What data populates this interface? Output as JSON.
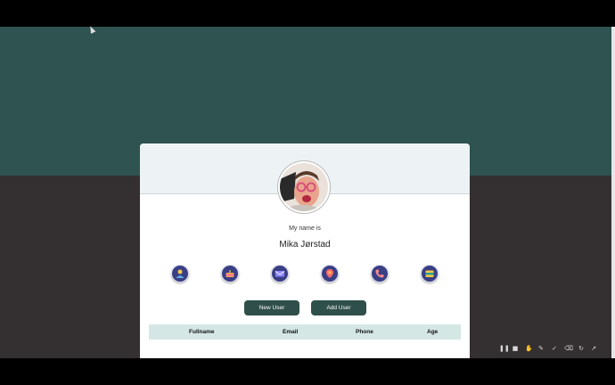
{
  "profile": {
    "intro_label": "My name is",
    "name": "Mika Jørstad"
  },
  "icons": [
    {
      "name": "user-icon",
      "color": "#f2c94c"
    },
    {
      "name": "calendar-icon",
      "color": "#f4a261"
    },
    {
      "name": "mail-icon",
      "color": "#6c63ff"
    },
    {
      "name": "map-pin-icon",
      "color": "#ff6b6b"
    },
    {
      "name": "phone-icon",
      "color": "#ff8a8a"
    },
    {
      "name": "lock-icon",
      "color": "#f2c94c"
    }
  ],
  "actions": {
    "new_user_label": "New User",
    "add_user_label": "Add User"
  },
  "table": {
    "columns": [
      "Fullname",
      "Email",
      "Phone",
      "Age"
    ]
  },
  "theme": {
    "accent": "#2f4f4a",
    "header_bg": "#edf3f4",
    "table_header_bg": "#d4e7e4",
    "page_top_bg": "#2e5350",
    "page_bottom_bg": "#342f31"
  },
  "screen_controls": [
    "pause-icon",
    "stop-icon",
    "pointer-icon",
    "pen-icon",
    "highlighter-icon",
    "eraser-icon",
    "refresh-icon",
    "expand-icon"
  ]
}
